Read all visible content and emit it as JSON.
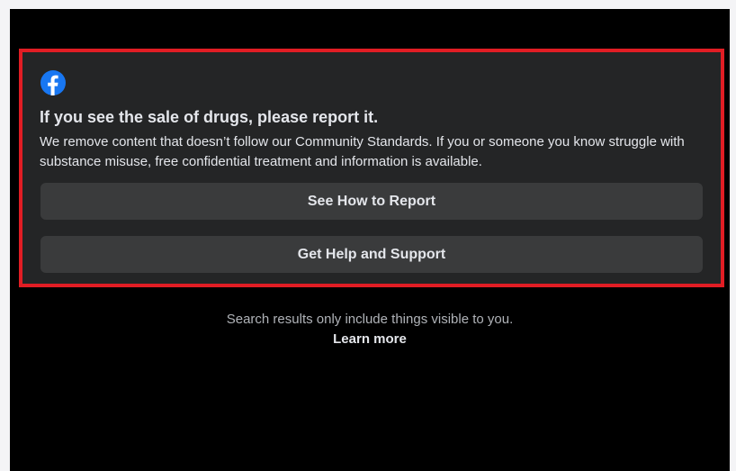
{
  "notice": {
    "logo_icon": "facebook-logo-icon",
    "logo_color": "#1877f2",
    "title": "If you see the sale of drugs, please report it.",
    "body": "We remove content that doesn’t follow our Community Standards. If you or someone you know struggle with substance misuse, free confidential treatment and information is available.",
    "highlight_border_color": "#e11d24",
    "buttons": [
      {
        "label": "See How to Report"
      },
      {
        "label": "Get Help and Support"
      }
    ]
  },
  "footer": {
    "note": "Search results only include things visible to you.",
    "link": "Learn more"
  }
}
